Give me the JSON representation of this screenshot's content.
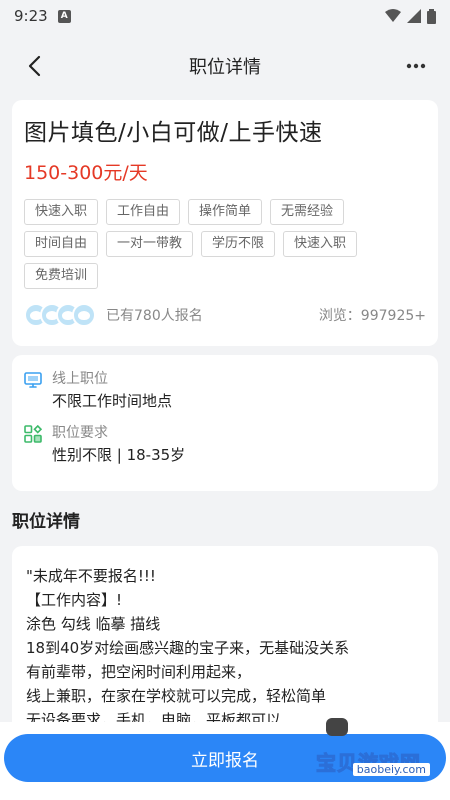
{
  "status": {
    "time": "9:23"
  },
  "nav": {
    "title": "职位详情"
  },
  "job": {
    "title": "图片填色/小白可做/上手快速",
    "salary": "150-300元/天",
    "tags": [
      "快速入职",
      "工作自由",
      "操作简单",
      "无需经验",
      "时间自由",
      "一对一带教",
      "学历不限",
      "快速入职",
      "免费培训"
    ],
    "signup_text": "已有780人报名",
    "views_text": "浏览：997925+"
  },
  "info": {
    "location_label": "线上职位",
    "location_value": "不限工作时间地点",
    "req_label": "职位要求",
    "req_value": "性别不限 | 18-35岁"
  },
  "details": {
    "section_title": "职位详情",
    "lines": [
      "\"未成年不要报名!!!",
      "【工作内容】!",
      "涂色  勾线 临摹 描线",
      "18到40岁对绘画感兴趣的宝子来，无基础没关系",
      "有前辈带，把空闲时间利用起来，",
      "线上兼职，在家在学校就可以完成，轻松简单",
      "无设备要求，手机，电脑，平板都可以"
    ]
  },
  "footer": {
    "apply_label": "立即报名"
  },
  "watermark": {
    "text": "宝贝游戏网",
    "domain": "baobeiy.com"
  },
  "colors": {
    "accent": "#2b86f7",
    "salary": "#e53926",
    "icon_blue": "#3aa0f0",
    "icon_green": "#3dba6a"
  }
}
